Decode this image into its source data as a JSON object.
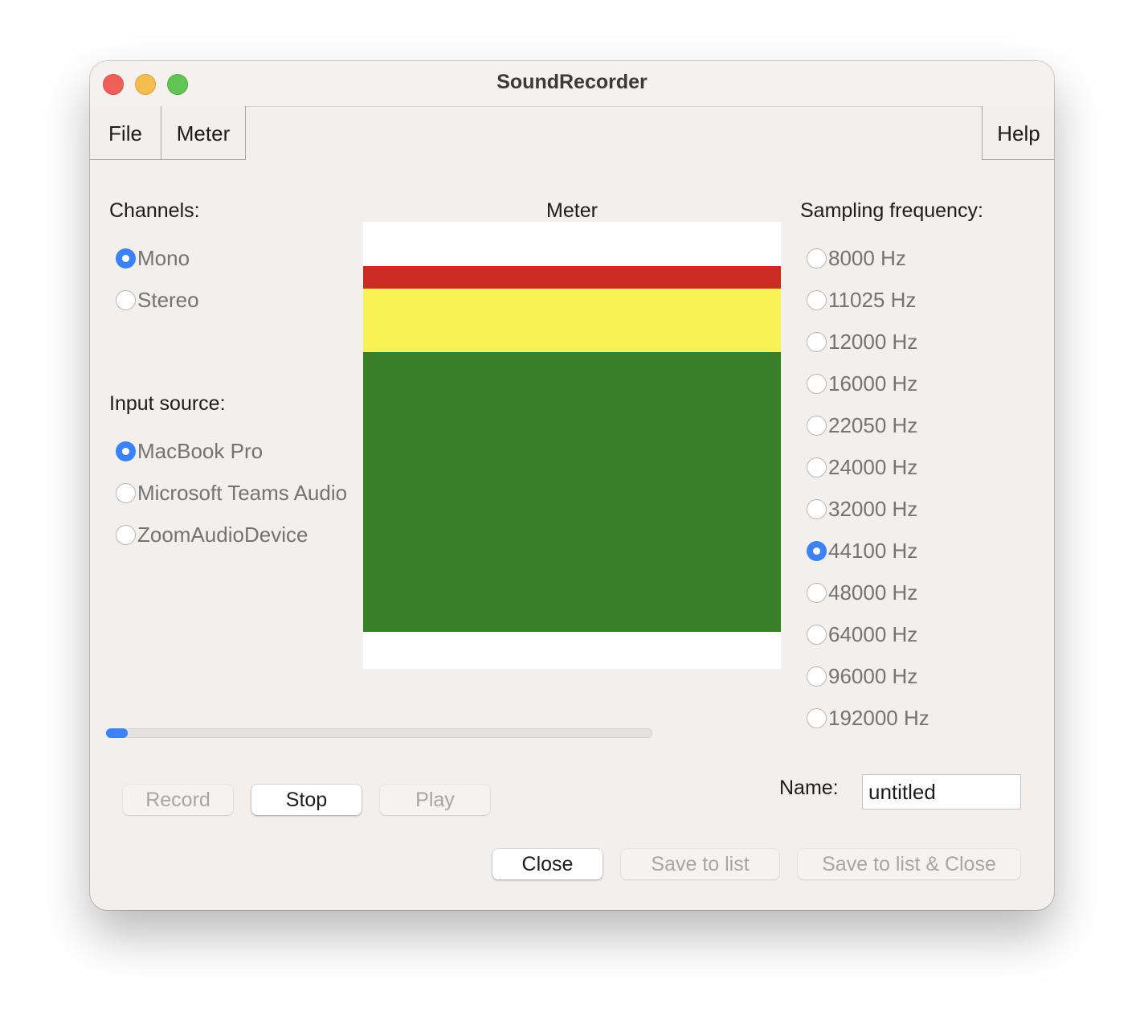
{
  "window": {
    "title": "SoundRecorder"
  },
  "menu": {
    "file": "File",
    "meter": "Meter",
    "help": "Help"
  },
  "channels": {
    "label": "Channels:",
    "options": [
      {
        "label": "Mono",
        "selected": true
      },
      {
        "label": "Stereo",
        "selected": false
      }
    ]
  },
  "input_source": {
    "label": "Input source:",
    "options": [
      {
        "label": "MacBook Pro",
        "selected": true
      },
      {
        "label": "Microsoft Teams Audio",
        "selected": false
      },
      {
        "label": "ZoomAudioDevice",
        "selected": false
      }
    ]
  },
  "meter": {
    "title": "Meter",
    "colors": {
      "red": "#cc2b22",
      "yellow": "#f8f153",
      "green": "#387f27"
    }
  },
  "sampling": {
    "label": "Sampling frequency:",
    "options": [
      {
        "label": "8000 Hz",
        "selected": false
      },
      {
        "label": "11025 Hz",
        "selected": false
      },
      {
        "label": "12000 Hz",
        "selected": false
      },
      {
        "label": "16000 Hz",
        "selected": false
      },
      {
        "label": "22050 Hz",
        "selected": false
      },
      {
        "label": "24000 Hz",
        "selected": false
      },
      {
        "label": "32000 Hz",
        "selected": false
      },
      {
        "label": "44100 Hz",
        "selected": true
      },
      {
        "label": "48000 Hz",
        "selected": false
      },
      {
        "label": "64000 Hz",
        "selected": false
      },
      {
        "label": "96000 Hz",
        "selected": false
      },
      {
        "label": "192000 Hz",
        "selected": false
      }
    ]
  },
  "progress": {
    "fraction": 0.04,
    "color": "#3b82f6"
  },
  "controls": {
    "record": "Record",
    "stop": "Stop",
    "play": "Play"
  },
  "name_field": {
    "label": "Name:",
    "value": "untitled"
  },
  "actions": {
    "close": "Close",
    "save_to_list": "Save to list",
    "save_to_list_close": "Save to list & Close"
  }
}
